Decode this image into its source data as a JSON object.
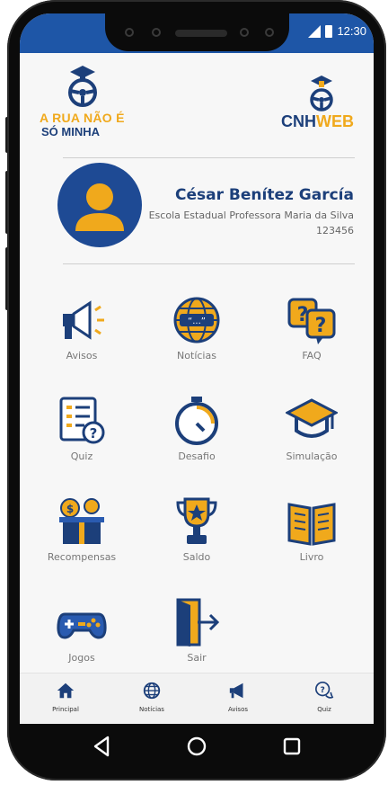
{
  "status": {
    "time": "12:30"
  },
  "header": {
    "left_logo": {
      "line1": "A RUA NÃO É",
      "line2": "SÓ MINHA"
    },
    "right_logo": {
      "part1": "CNH",
      "part2": "WEB"
    }
  },
  "profile": {
    "name": "César Benítez García",
    "school": "Escola Estadual Professora Maria da Silva",
    "id": "123456"
  },
  "menu": [
    {
      "label": "Avisos",
      "icon": "megaphone-icon"
    },
    {
      "label": "Notícias",
      "icon": "globe-news-icon"
    },
    {
      "label": "FAQ",
      "icon": "faq-chat-icon"
    },
    {
      "label": "Quiz",
      "icon": "quiz-checklist-icon"
    },
    {
      "label": "Desafio",
      "icon": "stopwatch-icon"
    },
    {
      "label": "Simulação",
      "icon": "graduation-cap-icon"
    },
    {
      "label": "Recompensas",
      "icon": "gift-box-icon"
    },
    {
      "label": "Saldo",
      "icon": "trophy-icon"
    },
    {
      "label": "Livro",
      "icon": "open-book-icon"
    },
    {
      "label": "Jogos",
      "icon": "gamepad-icon"
    },
    {
      "label": "Sair",
      "icon": "exit-door-icon"
    }
  ],
  "bottom_nav": [
    {
      "label": "Principal",
      "icon": "home-icon"
    },
    {
      "label": "Notícias",
      "icon": "globe-icon"
    },
    {
      "label": "Avisos",
      "icon": "megaphone-icon"
    },
    {
      "label": "Quiz",
      "icon": "question-bubble-icon"
    }
  ],
  "colors": {
    "primary": "#1c3f7a",
    "accent": "#f0a91c",
    "statusbar": "#1e56a7"
  }
}
